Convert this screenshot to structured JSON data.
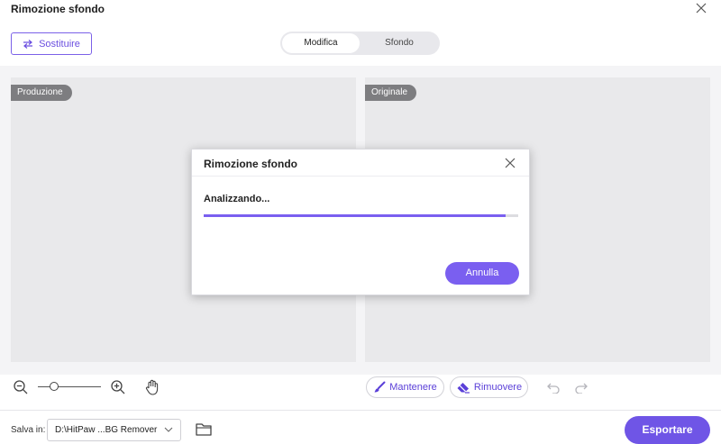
{
  "window": {
    "title": "Rimozione sfondo",
    "close_icon": "close-icon"
  },
  "toolbar": {
    "replace_label": "Sostituire",
    "replace_icon": "swap-icon"
  },
  "mode_tabs": [
    {
      "label": "Modifica",
      "active": true
    },
    {
      "label": "Sfondo",
      "active": false
    }
  ],
  "panels": {
    "left_label": "Produzione",
    "right_label": "Originale"
  },
  "zoom": {
    "level": 0.25
  },
  "actions": {
    "keep_label": "Mantenere",
    "remove_label": "Rimuovere"
  },
  "footer": {
    "save_label": "Salva in:",
    "path_value": "D:\\HitPaw ...BG Remover",
    "export_label": "Esportare"
  },
  "dialog": {
    "title": "Rimozione sfondo",
    "status": "Analizzando...",
    "progress": 0.96,
    "cancel_label": "Annulla"
  },
  "colors": {
    "accent": "#7a5ff0",
    "tag_bg": "#7d7d80",
    "panel_bg": "#e9e9eb"
  }
}
